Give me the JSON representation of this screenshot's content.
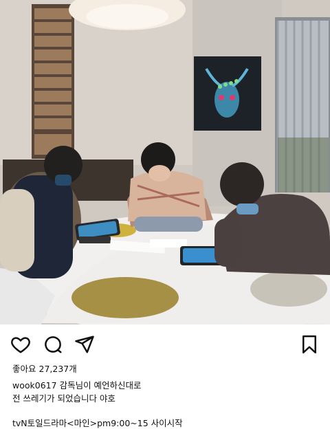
{
  "post": {
    "image_alt": "Three people studying tablets at a round white table in a lounge",
    "likes_label": "좋아요",
    "likes_count": "27,237개",
    "username": "wook0617",
    "caption_line1": "감독님이 예언하신대로",
    "caption_line2": "전 쓰레기가 되었습니다 야호",
    "caption_line3": "tvN토일드라마<마인>pm9:00~15 사이시작"
  },
  "icons": {
    "like": "heart-icon",
    "comment": "comment-icon",
    "share": "send-icon",
    "save": "bookmark-icon"
  }
}
